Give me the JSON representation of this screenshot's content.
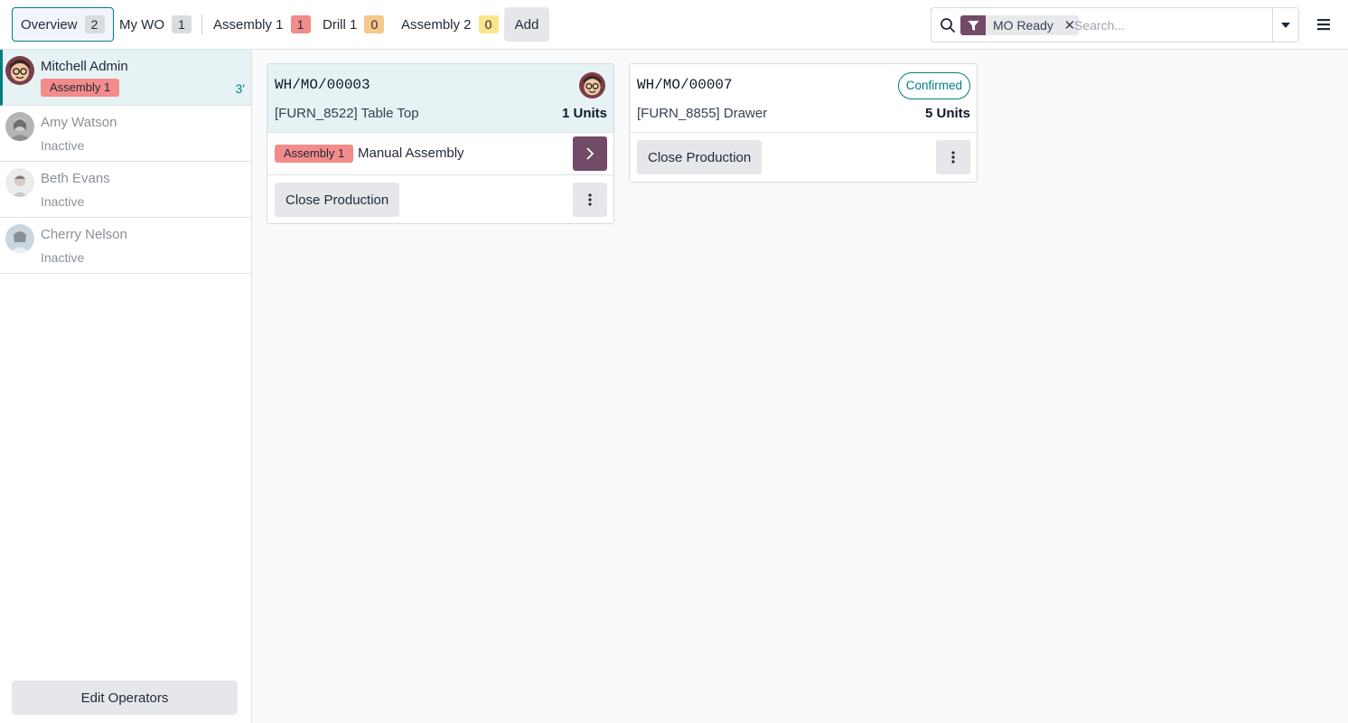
{
  "tabs": [
    {
      "label": "Overview",
      "count": "2",
      "active": true,
      "count_color": "#d9dcdf"
    },
    {
      "label": "My WO",
      "count": "1",
      "count_color": "#d9dcdf"
    },
    {
      "label": "Assembly 1",
      "count": "1",
      "count_color": "#f38b8b"
    },
    {
      "label": "Drill 1",
      "count": "0",
      "count_color": "#f8c78c"
    },
    {
      "label": "Assembly 2",
      "count": "0",
      "count_color": "#fce58c"
    }
  ],
  "add_label": "Add",
  "search": {
    "facet_label": "MO Ready",
    "placeholder": "Search..."
  },
  "operators": [
    {
      "name": "Mitchell Admin",
      "badge": "Assembly 1",
      "time": "3'",
      "active": true
    },
    {
      "name": "Amy Watson",
      "status": "Inactive"
    },
    {
      "name": "Beth Evans",
      "status": "Inactive"
    },
    {
      "name": "Cherry Nelson",
      "status": "Inactive"
    }
  ],
  "edit_operators_label": "Edit Operators",
  "cards": [
    {
      "ref": "WH/MO/00003",
      "product": "[FURN_8522] Table Top",
      "qty": "1 Units",
      "workorder": {
        "workcenter": "Assembly 1",
        "operation": "Manual Assembly"
      },
      "close_label": "Close Production"
    },
    {
      "ref": "WH/MO/00007",
      "product": "[FURN_8855] Drawer",
      "qty": "5 Units",
      "status": "Confirmed",
      "close_label": "Close Production"
    }
  ],
  "colors": {
    "brand": "#714b67",
    "accent": "#017e84",
    "workcenter_badge": "#f38b8b"
  }
}
